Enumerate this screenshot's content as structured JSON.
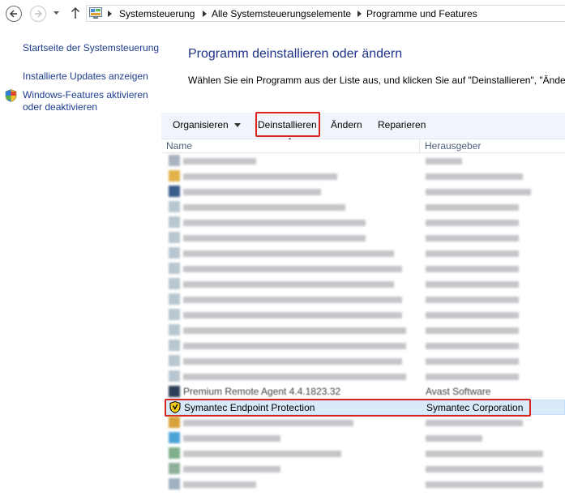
{
  "breadcrumb": [
    "Systemsteuerung",
    "Alle Systemsteuerungselemente",
    "Programme und Features"
  ],
  "left_pane": {
    "home": "Startseite der Systemsteuerung",
    "updates": "Installierte Updates anzeigen",
    "features_line1": "Windows-Features aktivieren",
    "features_line2": "oder deaktivieren"
  },
  "main": {
    "title": "Programm deinstallieren oder ändern",
    "instructions": "Wählen Sie ein Programm aus der Liste aus, und klicken Sie auf \"Deinstallieren\", \"Ändern"
  },
  "toolbar": {
    "organize": "Organisieren",
    "uninstall": "Deinstallieren",
    "change": "Ändern",
    "repair": "Reparieren"
  },
  "columns": {
    "name": "Name",
    "publisher": "Herausgeber"
  },
  "programs": {
    "premium": {
      "name": "Premium Remote Agent 4.4.1823.32",
      "publisher": "Avast Software"
    },
    "symantec": {
      "name": "Symantec Endpoint Protection",
      "publisher": "Symantec Corporation"
    }
  },
  "colors": {
    "highlight_border": "#d9231f",
    "selected_row": "#d9ebfb",
    "link": "#1c3c8e",
    "title": "#1e3287"
  },
  "icons": [
    "back-arrow-icon",
    "forward-arrow-icon",
    "chevron-down-icon",
    "up-arrow-icon",
    "control-panel-icon",
    "shield-icon",
    "symantec-icon"
  ]
}
